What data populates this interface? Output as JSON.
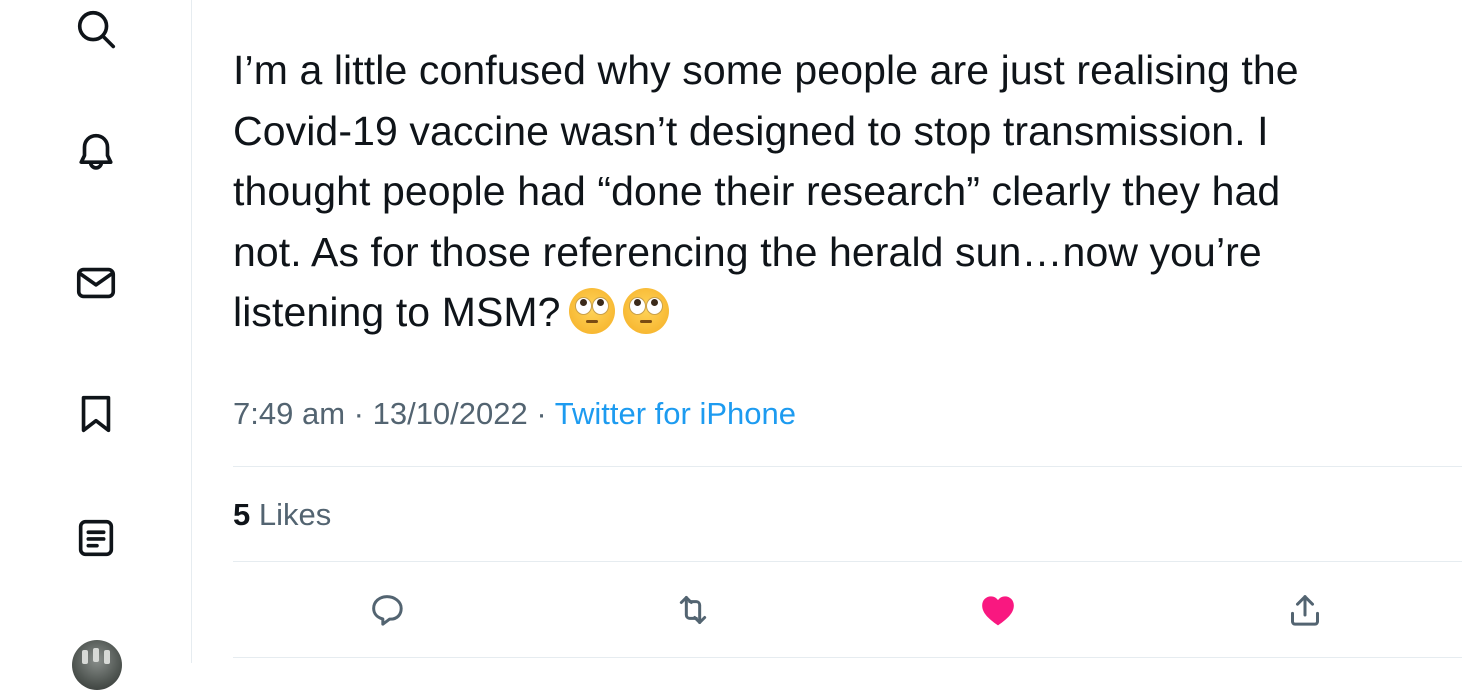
{
  "sidebar": {
    "icons": [
      "search-icon",
      "notifications-icon",
      "messages-icon",
      "bookmarks-icon",
      "lists-icon"
    ]
  },
  "tweet": {
    "text": "I’m a little confused why some people are just realising the\nCovid-19 vaccine wasn’t designed to stop transmission. I\nthought people had “done their research” clearly they had\nnot. As for those referencing the herald sun…now you’re\nlistening to MSM?",
    "time": "7:49 am",
    "separator": "·",
    "date": "13/10/2022",
    "source": "Twitter for iPhone",
    "likes_count": "5",
    "likes_label": "Likes",
    "emoji": "face-with-rolling-eyes"
  },
  "colors": {
    "accent": "#1d9bf0",
    "like": "#f91880",
    "secondary_text": "#536471",
    "divider": "#e6ecf0"
  }
}
